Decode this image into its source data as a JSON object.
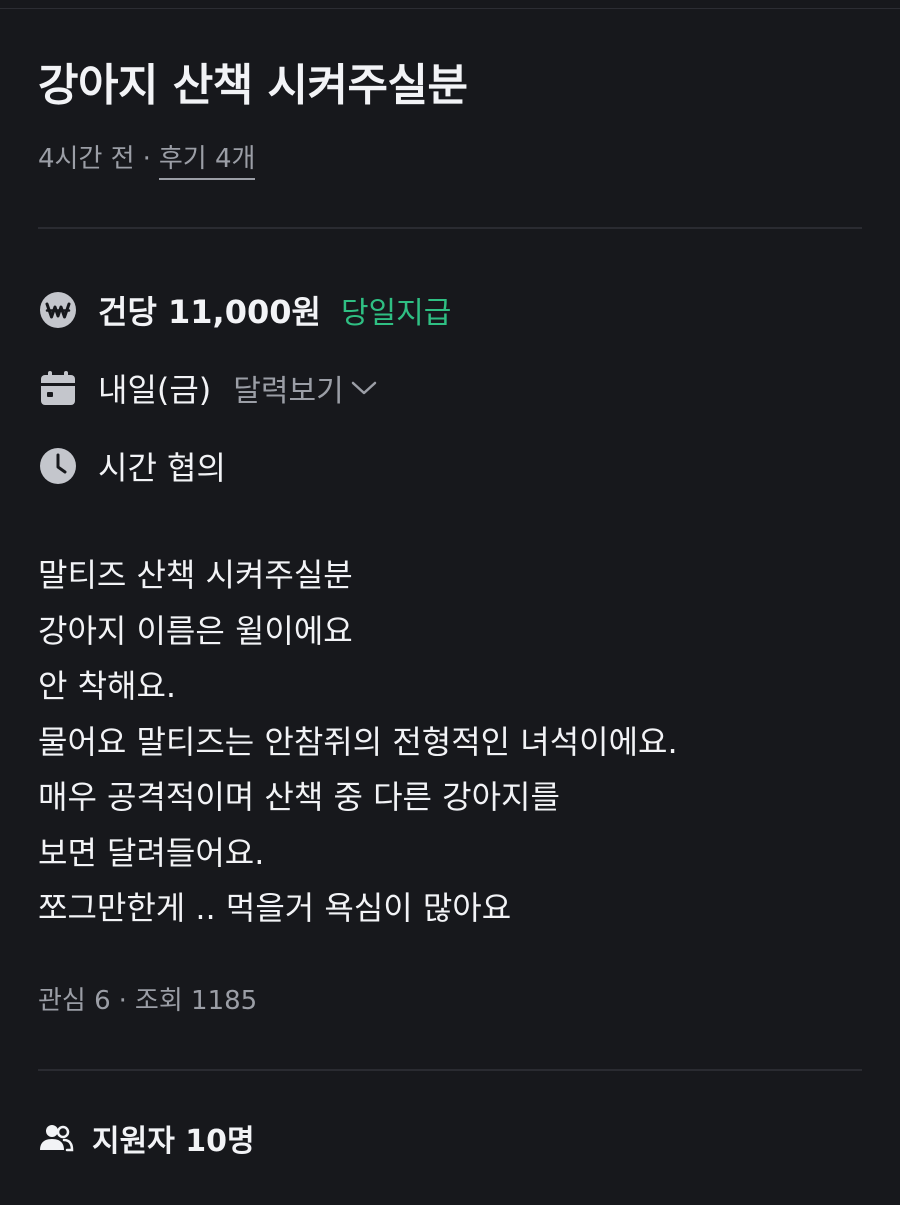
{
  "post": {
    "title": "강아지 산책 시켜주실분",
    "posted_ago": "4시간 전",
    "separator": "·",
    "reviews_label": "후기 4개"
  },
  "details": {
    "pay": {
      "icon": "won-coin-icon",
      "amount": "건당 11,000원",
      "badge": "당일지급",
      "badge_color": "#2fbf83"
    },
    "date": {
      "icon": "calendar-icon",
      "value": "내일(금)",
      "calendar_link": "달력보기"
    },
    "time": {
      "icon": "clock-icon",
      "value": "시간 협의"
    }
  },
  "description": {
    "lines": [
      "말티즈 산책 시켜주실분",
      "강아지 이름은 윌이에요",
      "안 착해요.",
      "물어요 말티즈는 안참쥐의 전형적인 녀석이에요.",
      "매우 공격적이며 산책 중 다른 강아지를",
      "보면 달려들어요.",
      "쪼그만한게 .. 먹을거 욕심이 많아요"
    ]
  },
  "stats": {
    "interest": "관심 6",
    "separator": "·",
    "views": "조회 1185"
  },
  "applicants": {
    "icon": "people-icon",
    "label": "지원자 10명"
  },
  "colors": {
    "background": "#17181c",
    "text_primary": "#f2f3f6",
    "text_secondary": "#9b9ea6",
    "accent_green": "#2fbf83"
  }
}
